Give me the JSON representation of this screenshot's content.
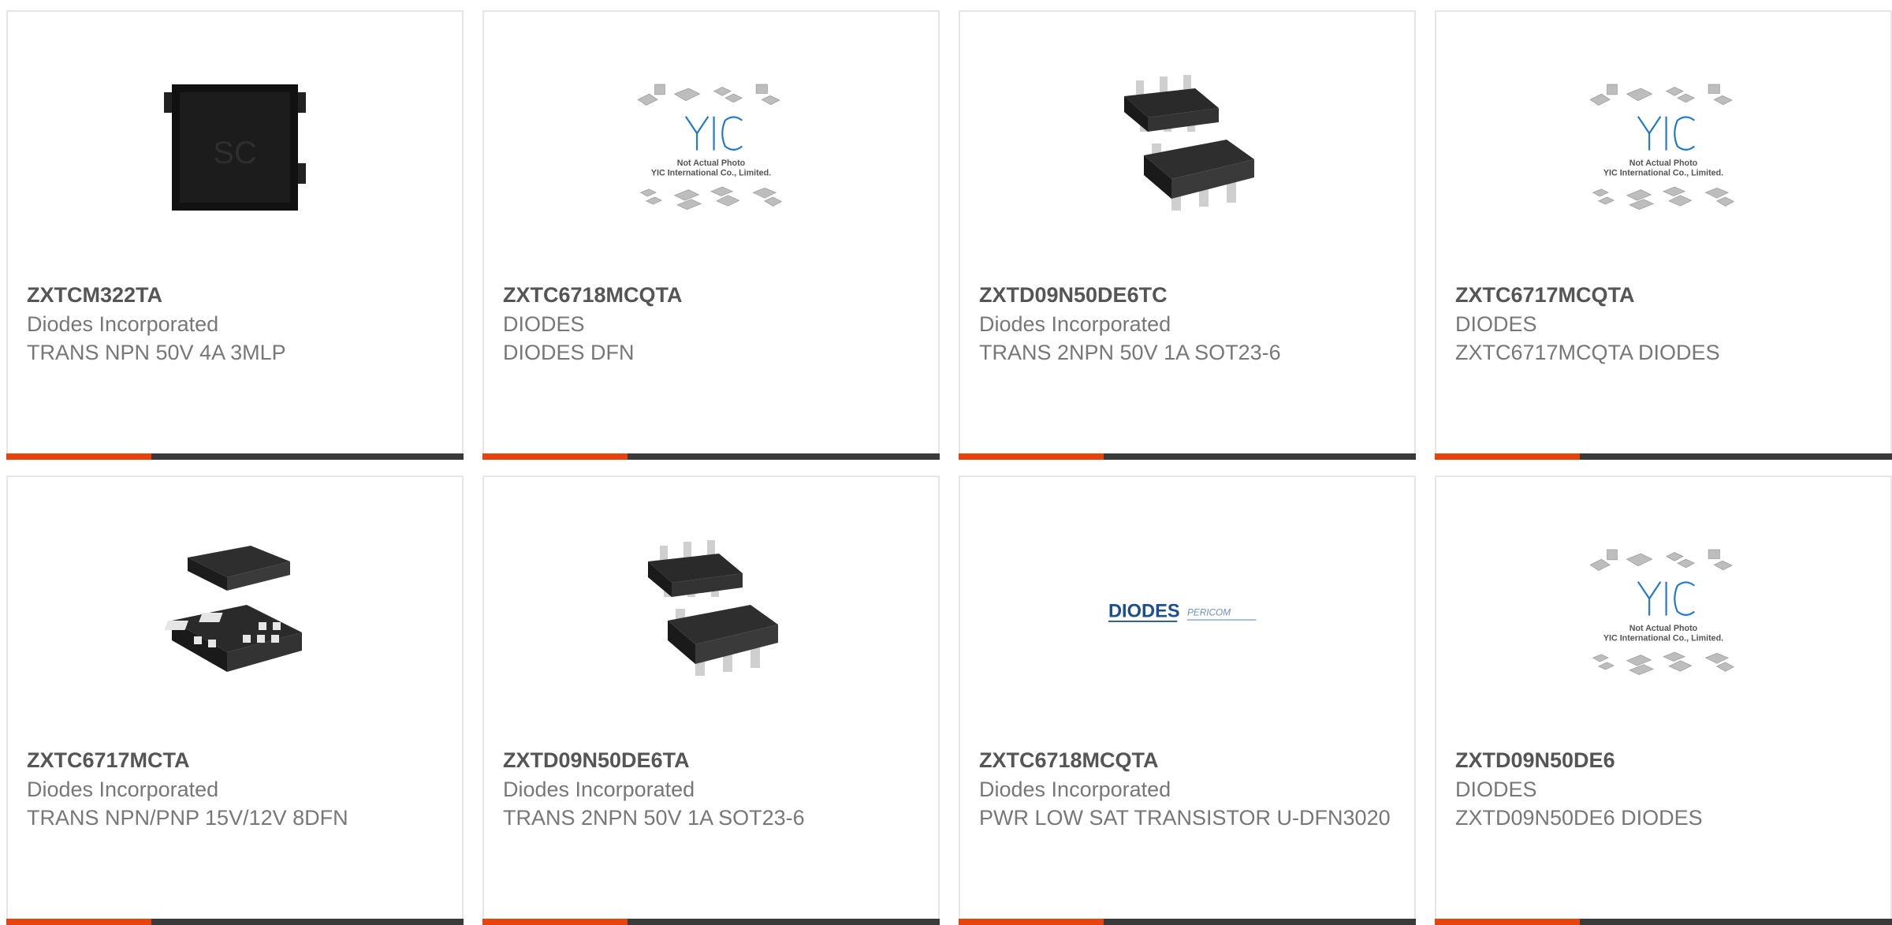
{
  "products": [
    {
      "part": "ZXTCM322TA",
      "manufacturer": "Diodes Incorporated",
      "description": "TRANS NPN 50V 4A 3MLP",
      "image": "chip-3mlp-icon"
    },
    {
      "part": "ZXTC6718MCQTA",
      "manufacturer": "DIODES",
      "description": "DIODES DFN",
      "image": "yic-placeholder-icon",
      "placeholder": {
        "logo": "YIC",
        "line1": "Not Actual Photo",
        "line2": "YIC International Co., Limited."
      }
    },
    {
      "part": "ZXTD09N50DE6TC",
      "manufacturer": "Diodes Incorporated",
      "description": "TRANS 2NPN 50V 1A SOT23-6",
      "image": "chip-sot23-6-icon"
    },
    {
      "part": "ZXTC6717MCQTA",
      "manufacturer": "DIODES",
      "description": "ZXTC6717MCQTA DIODES",
      "image": "yic-placeholder-icon",
      "placeholder": {
        "logo": "YIC",
        "line1": "Not Actual Photo",
        "line2": "YIC International Co., Limited."
      }
    },
    {
      "part": "ZXTC6717MCTA",
      "manufacturer": "Diodes Incorporated",
      "description": "TRANS NPN/PNP 15V/12V 8DFN",
      "image": "chip-8dfn-icon"
    },
    {
      "part": "ZXTD09N50DE6TA",
      "manufacturer": "Diodes Incorporated",
      "description": "TRANS 2NPN 50V 1A SOT23-6",
      "image": "chip-sot23-6-icon"
    },
    {
      "part": "ZXTC6718MCQTA",
      "manufacturer": "Diodes Incorporated",
      "description": "PWR LOW SAT TRANSISTOR U-DFN3020",
      "image": "diodes-logo-icon",
      "logo": {
        "brand": "DIODES",
        "sub": "PERICOM"
      }
    },
    {
      "part": "ZXTD09N50DE6",
      "manufacturer": "DIODES",
      "description": "ZXTD09N50DE6 DIODES",
      "image": "yic-placeholder-icon",
      "placeholder": {
        "logo": "YIC",
        "line1": "Not Actual Photo",
        "line2": "YIC International Co., Limited."
      }
    }
  ],
  "colors": {
    "accent": "#e8430c",
    "bar": "#3a3a3a",
    "part_text": "#555555",
    "meta_text": "#777777",
    "yic_blue": "#1e78c8"
  }
}
